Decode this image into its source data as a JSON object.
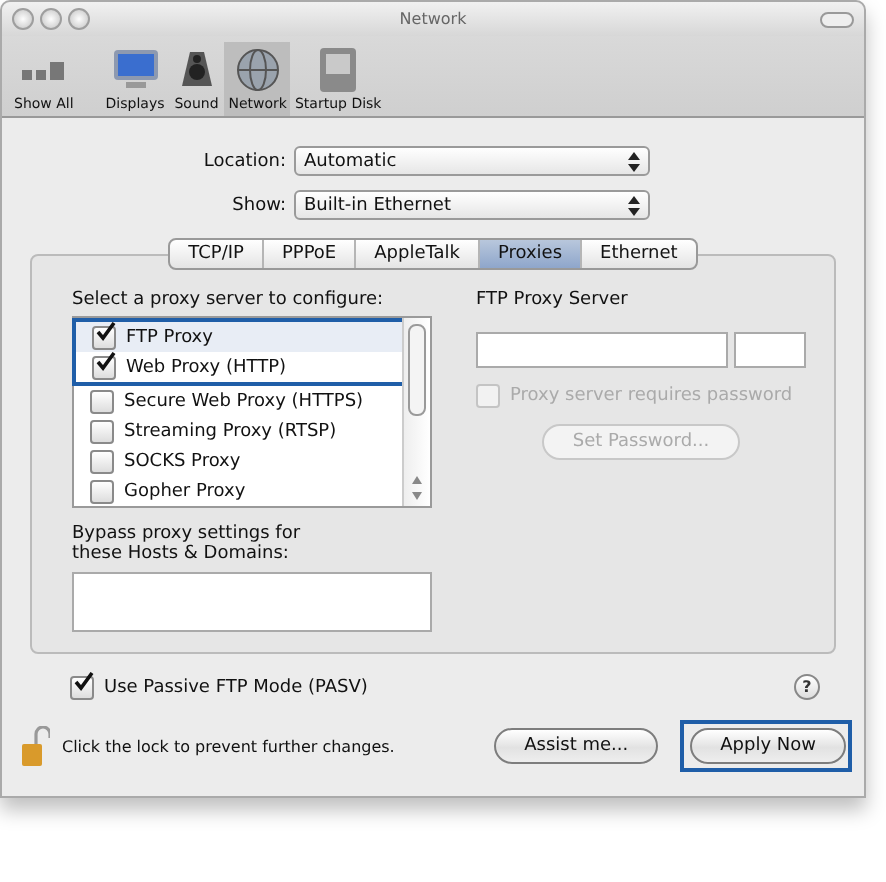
{
  "window": {
    "title": "Network"
  },
  "toolbar": [
    {
      "label": "Show All",
      "selected": false
    },
    {
      "label": "Displays",
      "selected": false
    },
    {
      "label": "Sound",
      "selected": false
    },
    {
      "label": "Network",
      "selected": true
    },
    {
      "label": "Startup Disk",
      "selected": false
    }
  ],
  "location": {
    "label": "Location:",
    "value": "Automatic"
  },
  "show": {
    "label": "Show:",
    "value": "Built-in Ethernet"
  },
  "tabs": [
    {
      "label": "TCP/IP",
      "selected": false
    },
    {
      "label": "PPPoE",
      "selected": false
    },
    {
      "label": "AppleTalk",
      "selected": false
    },
    {
      "label": "Proxies",
      "selected": true
    },
    {
      "label": "Ethernet",
      "selected": false
    }
  ],
  "proxies": {
    "heading": "Select a proxy server to configure:",
    "items": [
      {
        "label": "FTP Proxy",
        "checked": true,
        "selected": true,
        "highlighted": true
      },
      {
        "label": "Web Proxy (HTTP)",
        "checked": true,
        "selected": false,
        "highlighted": true
      },
      {
        "label": "Secure Web Proxy (HTTPS)",
        "checked": false,
        "selected": false,
        "highlighted": false
      },
      {
        "label": "Streaming Proxy (RTSP)",
        "checked": false,
        "selected": false,
        "highlighted": false
      },
      {
        "label": "SOCKS Proxy",
        "checked": false,
        "selected": false,
        "highlighted": false
      },
      {
        "label": "Gopher Proxy",
        "checked": false,
        "selected": false,
        "highlighted": false
      }
    ]
  },
  "bypass": {
    "label": "Bypass proxy settings for these Hosts & Domains:"
  },
  "server": {
    "label": "FTP Proxy Server",
    "password_checkbox": {
      "label": "Proxy server requires password",
      "checked": false,
      "disabled": true
    },
    "set_password": {
      "label": "Set Password...",
      "disabled": true
    }
  },
  "passive_ftp": {
    "label": "Use Passive FTP Mode (PASV)",
    "checked": true
  },
  "help": {
    "label": "?"
  },
  "footer": {
    "lock_text": "Click the lock to prevent further changes.",
    "buttons": [
      {
        "label": "Assist me...",
        "highlighted": false
      },
      {
        "label": "Apply Now",
        "highlighted": true
      }
    ]
  }
}
